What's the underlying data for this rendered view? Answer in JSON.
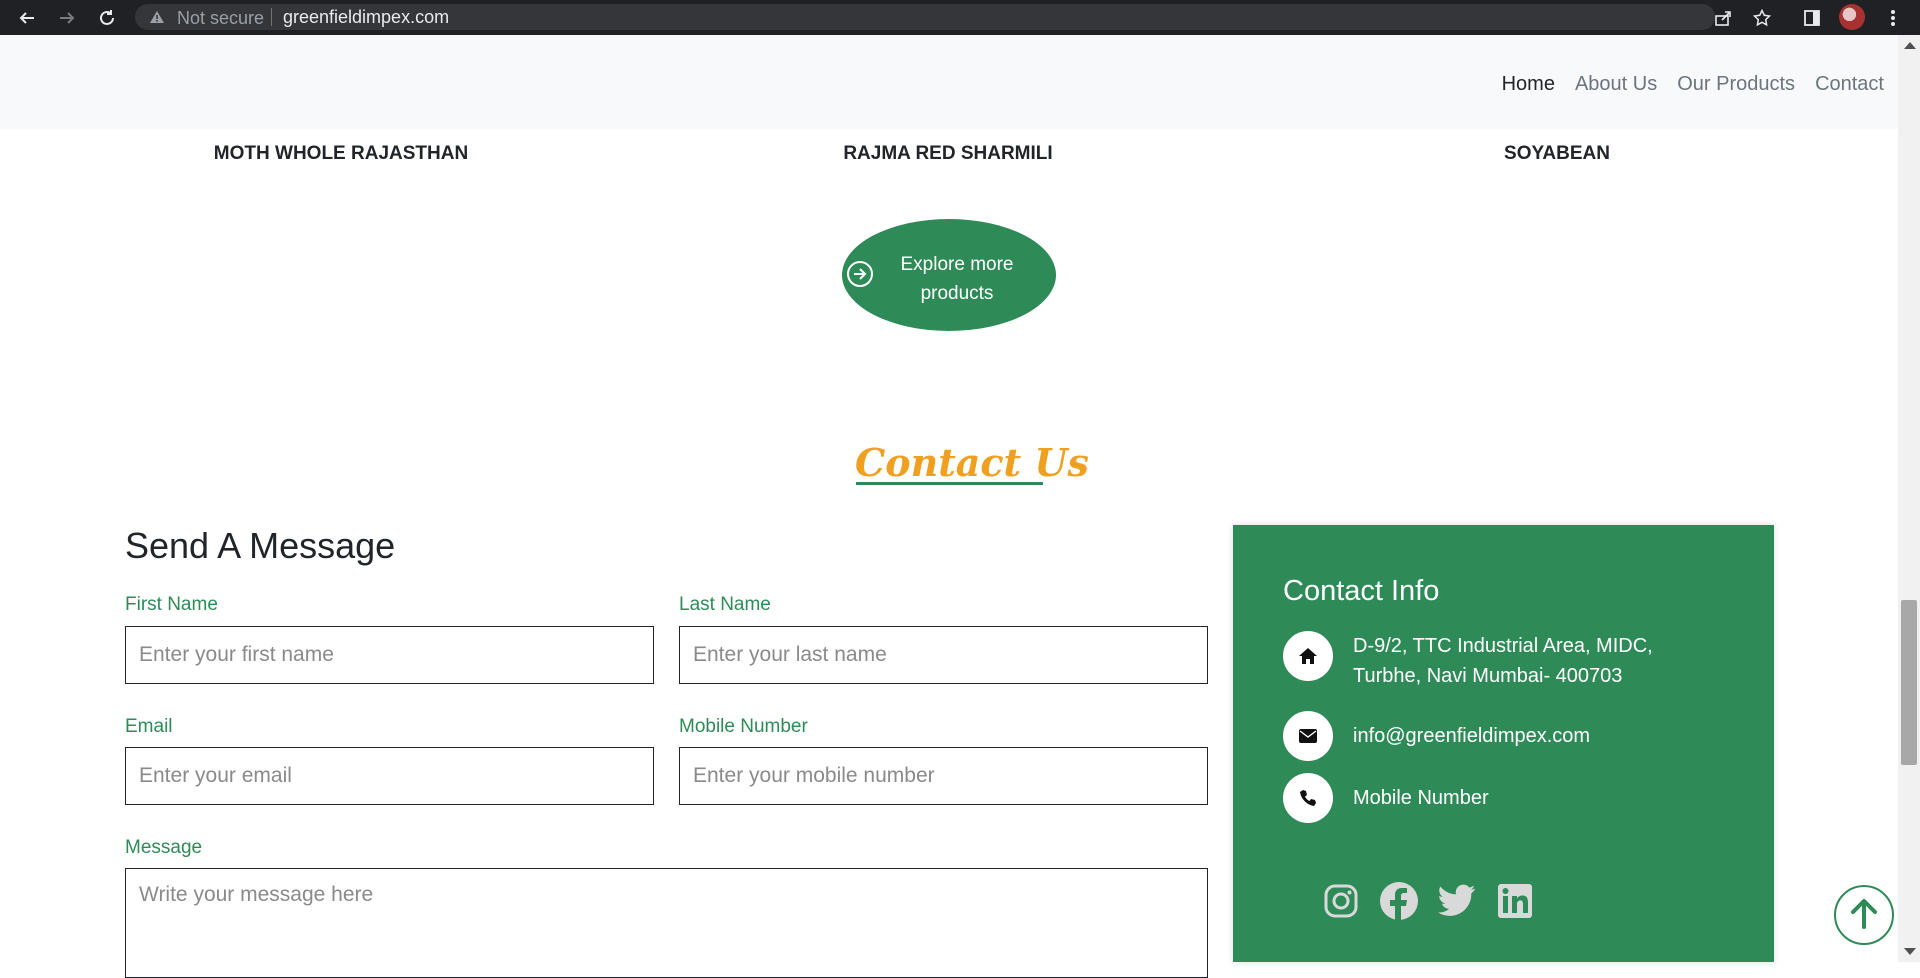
{
  "browser": {
    "security_label": "Not secure",
    "url": "greenfieldimpex.com"
  },
  "nav": {
    "items": [
      "Home",
      "About Us",
      "Our Products",
      "Contact"
    ]
  },
  "products": {
    "items": [
      "MOTH WHOLE RAJASTHAN",
      "RAJMA RED SHARMILI",
      "SOYABEAN"
    ],
    "explore_label": "Explore more products"
  },
  "contact": {
    "title": "Contact Us",
    "form": {
      "heading": "Send A Message",
      "first_name_label": "First Name",
      "first_name_placeholder": "Enter your first name",
      "last_name_label": "Last Name",
      "last_name_placeholder": "Enter your last name",
      "email_label": "Email",
      "email_placeholder": "Enter your email",
      "mobile_label": "Mobile Number",
      "mobile_placeholder": "Enter your mobile number",
      "message_label": "Message",
      "message_placeholder": "Write your message here"
    },
    "info": {
      "title": "Contact Info",
      "address": "D-9/2, TTC Industrial Area, MIDC, Turbhe, Navi Mumbai- 400703",
      "email": "info@greenfieldimpex.com",
      "phone": "Mobile Number"
    },
    "socials": [
      "instagram-icon",
      "facebook-icon",
      "twitter-icon",
      "linkedin-icon"
    ]
  },
  "colors": {
    "brand_green": "#2e8b57",
    "accent_orange": "#f0a020"
  }
}
